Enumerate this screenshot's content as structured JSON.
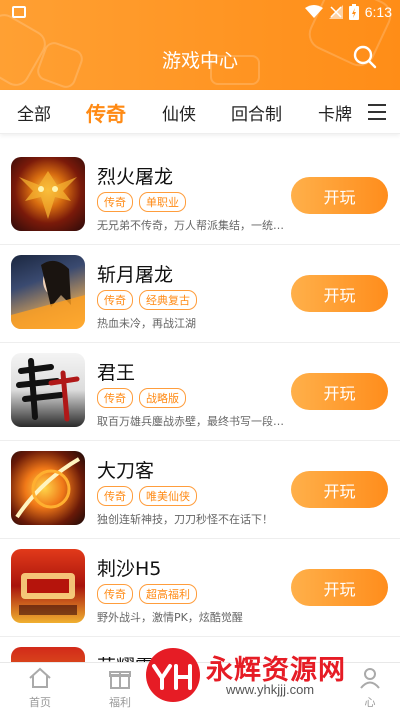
{
  "status_bar": {
    "time": "6:13"
  },
  "header": {
    "title": "游戏中心"
  },
  "tabs": [
    {
      "label": "全部",
      "active": false
    },
    {
      "label": "传奇",
      "active": true
    },
    {
      "label": "仙侠",
      "active": false
    },
    {
      "label": "回合制",
      "active": false
    },
    {
      "label": "卡牌",
      "active": false
    }
  ],
  "games": [
    {
      "name": "烈火屠龙",
      "tags": [
        "传奇",
        "单职业"
      ],
      "desc": "无兄弟不传奇，万人帮派集结，一统…",
      "button": "开玩",
      "icon": "dragon-game-icon"
    },
    {
      "name": "斩月屠龙",
      "tags": [
        "传奇",
        "经典复古"
      ],
      "desc": "热血未冷，再战江湖",
      "button": "开玩",
      "icon": "warrior-woman-game-icon"
    },
    {
      "name": "君王",
      "tags": [
        "传奇",
        "战略版"
      ],
      "desc": "取百万雄兵鏖战赤壁，最终书写一段…",
      "button": "开玩",
      "icon": "calligraphy-game-icon"
    },
    {
      "name": "大刀客",
      "tags": [
        "传奇",
        "唯美仙侠"
      ],
      "desc": "独创连斩神技，刀刀秒怪不在话下！",
      "button": "开玩",
      "icon": "blade-game-icon"
    },
    {
      "name": "刺沙H5",
      "tags": [
        "传奇",
        "超高福利"
      ],
      "desc": "野外战斗，激情PK，炫酷觉醒",
      "button": "开玩",
      "icon": "red-game-icon"
    },
    {
      "name": "荣耀霸业",
      "tags": [],
      "desc": "",
      "button": "",
      "icon": "glory-game-icon"
    }
  ],
  "bottom_nav": [
    {
      "label": "首页",
      "icon": "home-icon"
    },
    {
      "label": "福利",
      "icon": "gift-icon"
    },
    {
      "label": "心",
      "icon": "user-icon"
    }
  ],
  "watermark": {
    "brand": "永辉资源网",
    "url": "www.yhkjjj.com"
  },
  "colors": {
    "accent": "#ff8d17",
    "tag": "#ff8a14"
  }
}
